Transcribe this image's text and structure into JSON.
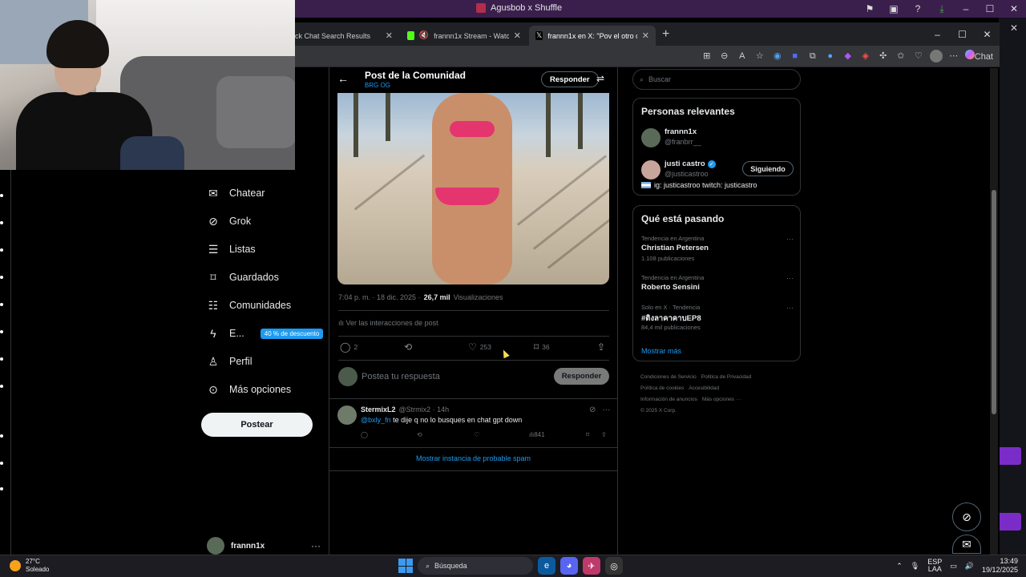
{
  "outer_window": {
    "title": "Agusbob x Shuffle"
  },
  "browser": {
    "tabs": [
      {
        "label": "ck Chat Search Results",
        "active": false
      },
      {
        "label": "frannn1x Stream - Watch Live",
        "active": false
      },
      {
        "label": "frannn1x en X: \"Pov el otro down",
        "active": true
      }
    ],
    "toolbar": {
      "chat_label": "Chat"
    }
  },
  "nav": {
    "items": [
      {
        "label": "Chatear",
        "icon": "mail-icon"
      },
      {
        "label": "Grok",
        "icon": "grok-icon"
      },
      {
        "label": "Listas",
        "icon": "list-icon"
      },
      {
        "label": "Guardados",
        "icon": "bookmark-icon"
      },
      {
        "label": "Comunidades",
        "icon": "communities-icon"
      },
      {
        "label": "E...",
        "icon": "lightning-icon"
      },
      {
        "label": "Perfil",
        "icon": "profile-icon"
      },
      {
        "label": "Más opciones",
        "icon": "more-icon"
      }
    ],
    "promo_badge": "40 % de descuento",
    "post_button": "Postear",
    "account_name": "frannn1x"
  },
  "post": {
    "header_title": "Post de la Comunidad",
    "header_sub": "BRG OG",
    "reply_header_button": "Responder",
    "time": "7:04 p. m. · 18 dic. 2025 ·",
    "views_count": "26,7 mil",
    "views_label": "Visualizaciones",
    "interactions_link": "Ver las interacciones de post",
    "replies": "2",
    "likes": "253",
    "bookmarks": "36",
    "reply_placeholder": "Postea tu respuesta",
    "reply_button": "Responder"
  },
  "reply_tweet": {
    "name": "StermixL2",
    "handle": "@Strmix2 · 14h",
    "mention": "@bxly_fn",
    "text": "te dije q no lo busques en chat gpt down",
    "views": "841"
  },
  "spam_link": "Mostrar instancia de probable spam",
  "sidebar": {
    "search_placeholder": "Buscar",
    "relevant_title": "Personas relevantes",
    "people": [
      {
        "name": "frannn1x",
        "handle": "@franbrr__"
      },
      {
        "name": "justi castro",
        "handle": "@justicastroo",
        "follow_label": "Siguiendo"
      }
    ],
    "bio": "ig: justicastroo twitch: justicastro",
    "trends_title": "Qué está pasando",
    "trends": [
      {
        "context": "Tendencia en Argentina",
        "name": "Christian Petersen",
        "count": "1.108 publicaciones"
      },
      {
        "context": "Tendencia en Argentina",
        "name": "Roberto Sensini",
        "count": ""
      },
      {
        "context": "Solo en X · Tendencia",
        "name": "#ติงลาคาคาบEP8",
        "count": "84,4 mil publicaciones"
      }
    ],
    "show_more": "Mostrar más",
    "footer_links": [
      "Condiciones de Servicio",
      "Política de Privacidad",
      "Política de cookies",
      "Accesibilidad",
      "Información de anuncios",
      "Más opciones ···",
      "© 2025 X Corp."
    ]
  },
  "taskbar": {
    "temperature": "27°C",
    "weather": "Soleado",
    "search_label": "Búsqueda",
    "lang_top": "ESP",
    "lang_bottom": "LAA",
    "time": "13:49",
    "date": "19/12/2025"
  }
}
